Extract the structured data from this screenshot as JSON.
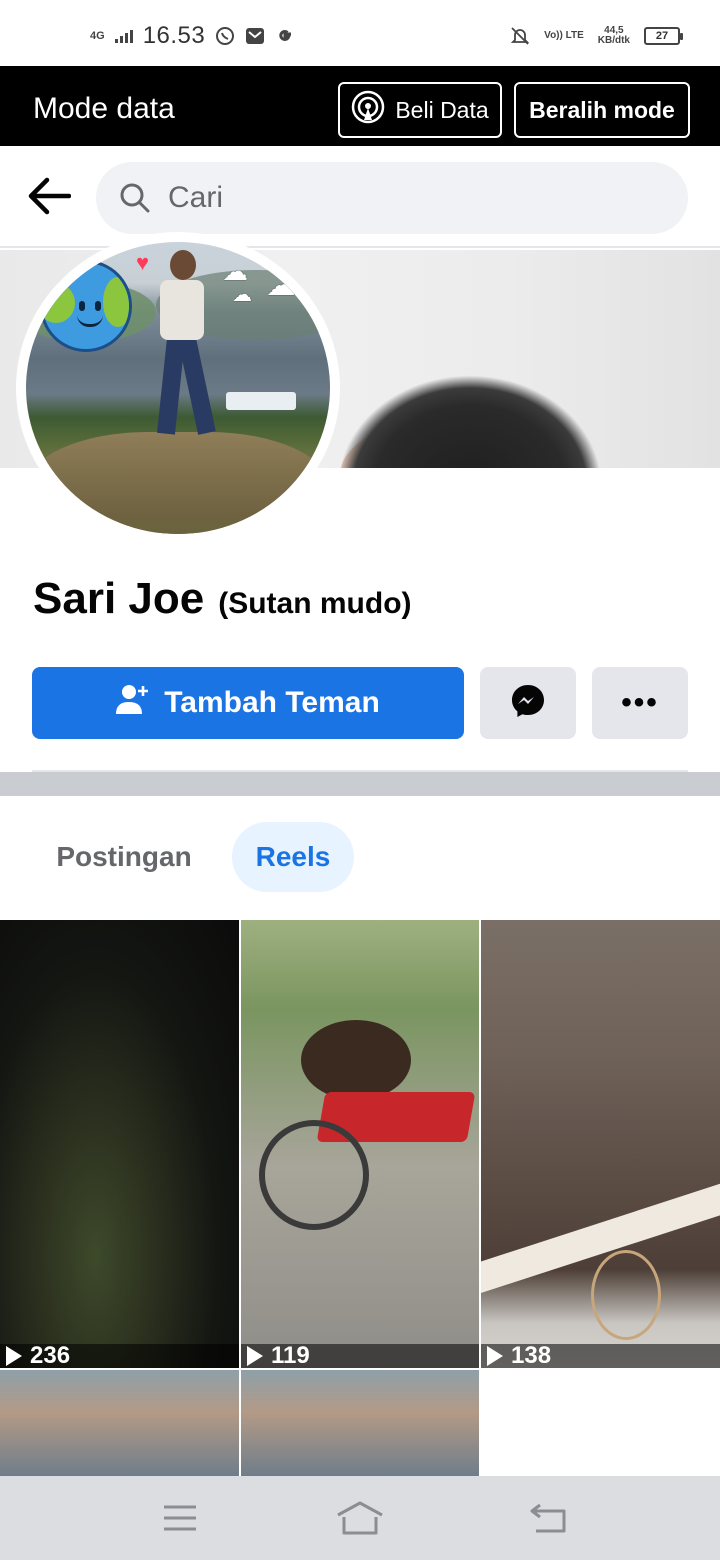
{
  "status_bar": {
    "network": "4G",
    "time": "16.53",
    "volte": "Vo)) LTE",
    "speed_value": "44,5",
    "speed_unit": "KB/dtk",
    "battery": "27",
    "icons": [
      "signal-icon",
      "whatsapp-icon",
      "mail-icon",
      "google-icon",
      "mute-bell-icon",
      "battery-icon"
    ]
  },
  "data_mode_bar": {
    "title": "Mode data",
    "buy_data_label": "Beli Data",
    "switch_mode_label": "Beralih mode"
  },
  "search": {
    "placeholder": "Cari"
  },
  "profile": {
    "name": "Sari Joe",
    "alternate_name": "(Sutan mudo)",
    "add_friend_label": "Tambah Teman",
    "more_label": "•••"
  },
  "tabs": [
    {
      "label": "Postingan",
      "active": false
    },
    {
      "label": "Reels",
      "active": true
    }
  ],
  "reels": [
    {
      "views": "236"
    },
    {
      "views": "119"
    },
    {
      "views": "138"
    },
    {
      "views": ""
    },
    {
      "views": ""
    }
  ],
  "colors": {
    "primary_blue": "#1b74e4",
    "tab_active_bg": "#e7f3ff",
    "button_grey": "#e4e6eb",
    "mode_bar_bg": "#000000"
  }
}
